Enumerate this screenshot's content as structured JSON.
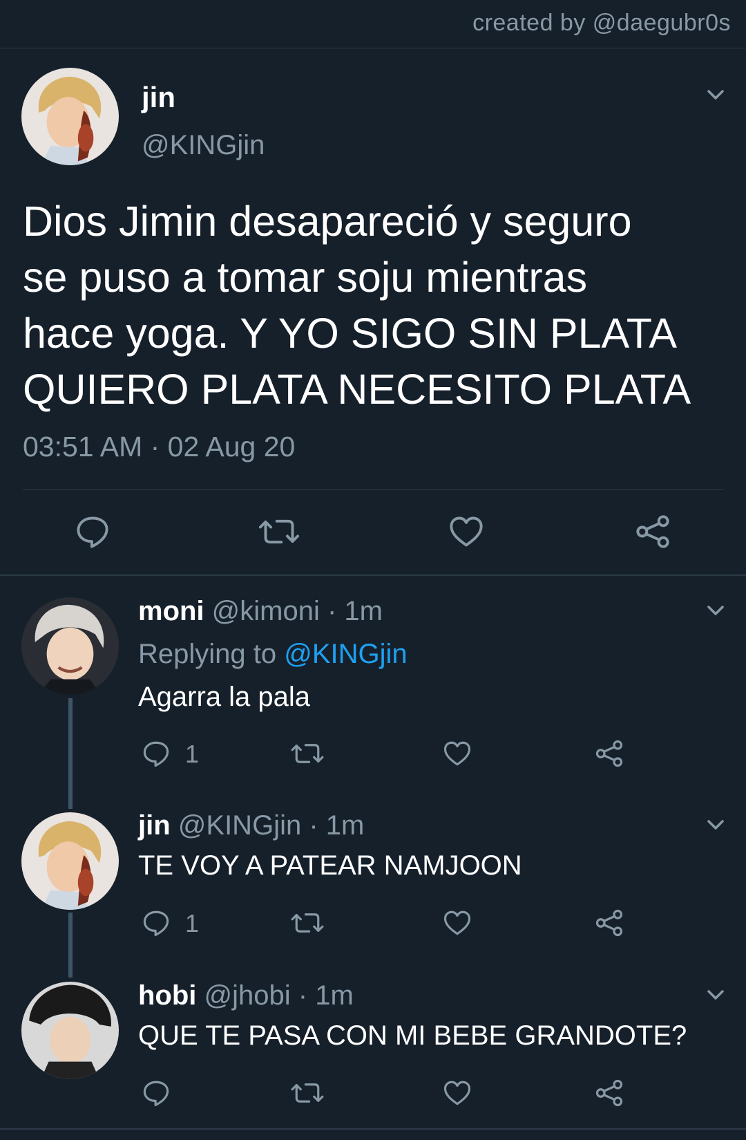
{
  "header": {
    "credit": "created by @daegubr0s"
  },
  "tweet": {
    "name": "jin",
    "handle": "@KINGjin",
    "text_lines": [
      "Dios Jimin desapareció y seguro",
      "se puso a tomar soju mientras",
      "hace yoga. Y YO SIGO SIN PLATA",
      "QUIERO PLATA NECESITO PLATA"
    ],
    "meta": "03:51 AM · 02 Aug 20"
  },
  "replies": [
    {
      "name": "moni",
      "handle_time": " @kimoni · 1m",
      "replying_label": "Replying to ",
      "replying_mention": "@KINGjin",
      "text": "Agarra la pala",
      "reply_count": "1"
    },
    {
      "name": "jin",
      "handle_time": " @KINGjin · 1m",
      "text": "TE VOY A PATEAR NAMJOON",
      "reply_count": "1"
    },
    {
      "name": "hobi",
      "handle_time": " @jhobi · 1m",
      "text": "QUE TE PASA CON MI BEBE GRANDOTE?",
      "reply_count": ""
    }
  ],
  "colors": {
    "background": "#16202b",
    "muted": "#8899a6",
    "link": "#1da1f2",
    "divider": "#2b3946"
  },
  "icons": [
    "reply-icon",
    "retweet-icon",
    "like-icon",
    "share-icon",
    "chevron-down-icon"
  ]
}
